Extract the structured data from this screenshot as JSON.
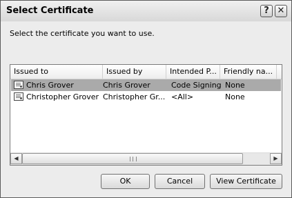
{
  "dialog": {
    "title": "Select Certificate",
    "help_glyph": "?",
    "close_glyph": "✕",
    "prompt": "Select the certificate you want to use."
  },
  "list": {
    "columns": [
      "Issued to",
      "Issued by",
      "Intended P...",
      "Friendly na..."
    ],
    "rows": [
      {
        "issued_to": "Chris Grover",
        "issued_by": "Chris Grover",
        "intended_purpose": "Code Signing",
        "friendly_name": "None",
        "selected": true
      },
      {
        "issued_to": "Christopher Grover",
        "issued_by": "Christopher Gr...",
        "intended_purpose": "<All>",
        "friendly_name": "None",
        "selected": false
      }
    ],
    "scroll_left_glyph": "◀",
    "scroll_right_glyph": "▶"
  },
  "buttons": {
    "ok": "OK",
    "cancel": "Cancel",
    "view": "View Certificate"
  },
  "icons": {
    "row_icon": "certificate-icon",
    "help": "help-icon",
    "close": "close-icon"
  }
}
